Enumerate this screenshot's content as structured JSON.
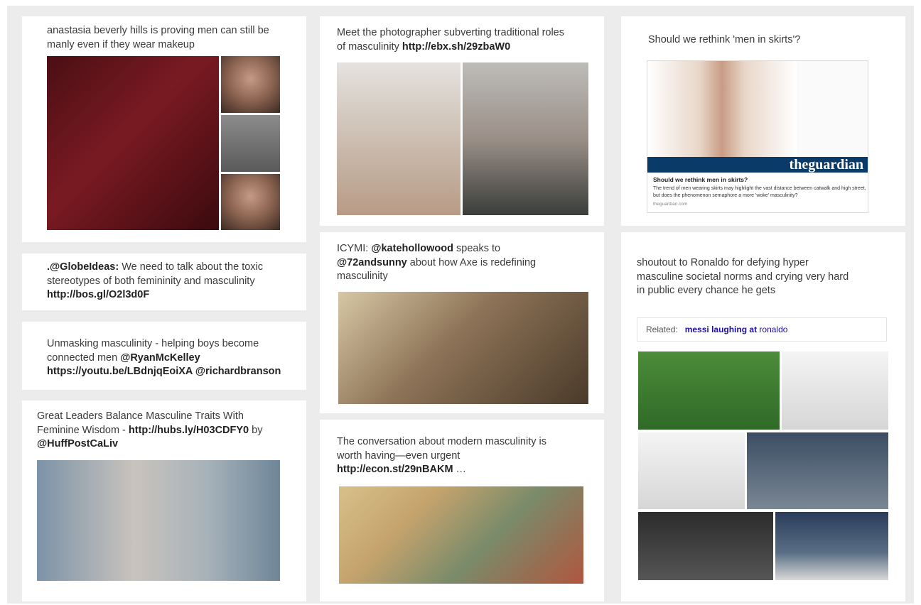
{
  "cards": {
    "c1": {
      "text": "anastasia beverly hills is proving men can still be manly even if they wear makeup"
    },
    "c2": {
      "pre": "Meet the photographer subverting traditional roles of masculinity ",
      "link": "http://ebx.sh/29zbaW0"
    },
    "c3": {
      "text": "Should we rethink 'men in skirts'?",
      "embed": {
        "brand": "theguardian",
        "title": "Should we rethink men in skirts?",
        "desc": "The trend of men wearing skirts may highlight the vast distance between catwalk and high street, but does the phenomenon semaphore a more 'woke' masculinity?",
        "url": "theguardian.com"
      }
    },
    "c4": {
      "handle": ".@GlobeIdeas:",
      "text": " We need to talk about the toxic stereotypes of both femininity and masculinity ",
      "link": "http://bos.gl/O2l3d0F"
    },
    "c5": {
      "pre": "ICYMI: ",
      "h1": "@katehollowood",
      "mid": " speaks to ",
      "h2": "@72andsunny",
      "post": " about how Axe is redefining masculinity"
    },
    "c6": {
      "text": "shoutout to Ronaldo for defying hyper masculine societal norms and crying very hard in public every chance he gets",
      "related_label": "Related:",
      "related_query_bold": "messi laughing at",
      "related_query_rest": " ronaldo"
    },
    "c7": {
      "pre": "Unmasking masculinity - helping boys become connected men ",
      "h1": "@RyanMcKelley",
      "link": "https://youtu.be/LBdnjqEoiXA",
      "h2": " @richardbranson"
    },
    "c8": {
      "pre": "Great Leaders Balance Masculine Traits With Feminine Wisdom - ",
      "link": "http://hubs.ly/H03CDFY0",
      "mid": " by ",
      "handle": "@HuffPostCaLiv"
    },
    "c9": {
      "pre": "The conversation about modern masculinity is worth having—even urgent ",
      "link": "http://econ.st/29nBAKM",
      "post": " …"
    }
  }
}
